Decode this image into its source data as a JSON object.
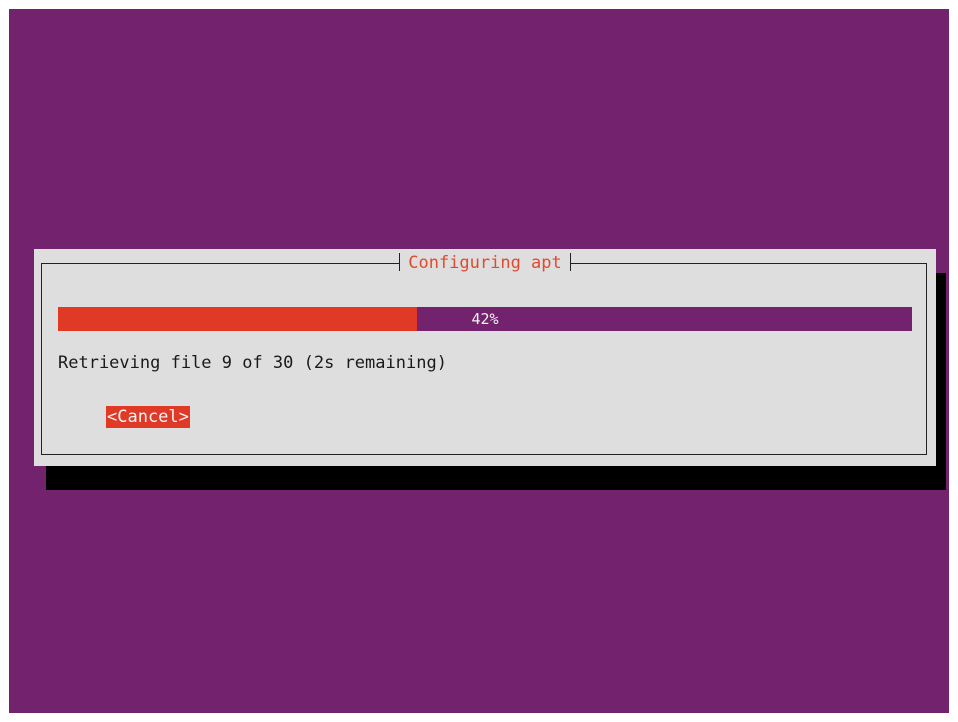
{
  "dialog": {
    "title": "Configuring apt",
    "progress": {
      "percent": 42,
      "label": "42%"
    },
    "status": "Retrieving file 9 of 30 (2s remaining)",
    "cancel_label": "<Cancel>"
  },
  "colors": {
    "background": "#73236d",
    "dialog": "#dedede",
    "accent": "#e03a27",
    "title_text": "#e04a2f",
    "shadow": "#000000"
  }
}
